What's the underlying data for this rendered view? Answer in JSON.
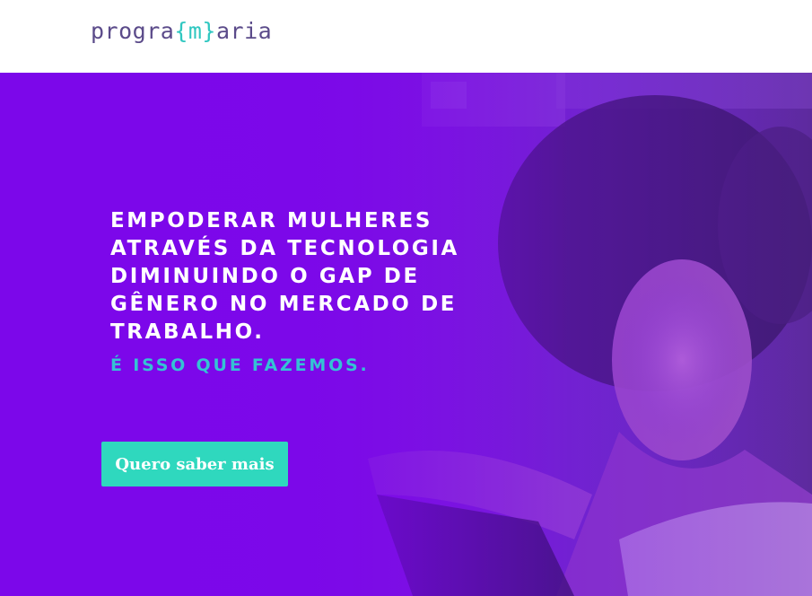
{
  "header": {
    "logo": {
      "before": "progra",
      "accent": "{m}",
      "after": "aria"
    }
  },
  "hero": {
    "headline": "EMPODERAR MULHERES ATRAVÉS DA TECNOLOGIA DIMINUINDO O GAP DE GÊNERO NO MERCADO DE TRABALHO.",
    "subheadline": "É ISSO QUE FAZEMOS.",
    "cta_label": "Quero saber mais"
  },
  "colors": {
    "brand_purple": "#7c07ea",
    "logo_text": "#5b4b8a",
    "accent_teal": "#2fc7c0",
    "subheadline": "#34c3d4",
    "cta_background": "#2fd8be"
  }
}
